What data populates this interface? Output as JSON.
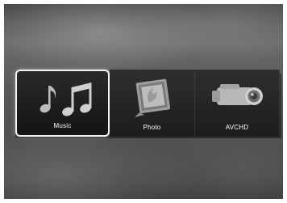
{
  "menu": {
    "items": [
      {
        "label": "Music",
        "icon": "music-notes-icon",
        "selected": true
      },
      {
        "label": "Photo",
        "icon": "picture-frame-icon",
        "selected": false
      },
      {
        "label": "AVCHD",
        "icon": "camcorder-icon",
        "selected": false
      }
    ]
  },
  "colors": {
    "selection_border": "#f2f2f2",
    "label_text": "#ffffff",
    "tile_background": "#1c1c1c"
  }
}
